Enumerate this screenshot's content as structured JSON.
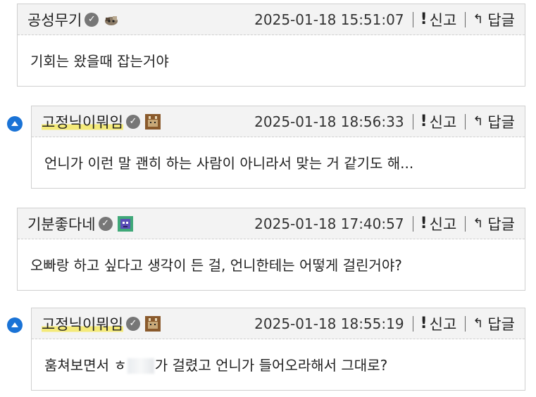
{
  "comments": [
    {
      "nickname": "공성무기",
      "verified_mark": "✓",
      "level_icon": "rock-mascot-icon",
      "date": "2025-01-18 15:51:07",
      "report_label": "신고",
      "reply_label": "답글",
      "text": "기회는 왔을때 잡는거야",
      "is_reply": false
    },
    {
      "nickname": "고정닉이뭐임",
      "verified_mark": "✓",
      "level_icon": "brown-character-icon",
      "date": "2025-01-18 18:56:33",
      "report_label": "신고",
      "reply_label": "답글",
      "text": "언니가 이런 말 괜히 하는 사람이 아니라서 맞는 거 같기도 해...",
      "is_reply": true
    },
    {
      "nickname": "기분좋다네",
      "verified_mark": "✓",
      "level_icon": "green-purple-character-icon",
      "date": "2025-01-18 17:40:57",
      "report_label": "신고",
      "reply_label": "답글",
      "text": "오빠랑 하고 싶다고 생각이 든 걸, 언니한테는 어떻게 걸린거야?",
      "is_reply": false
    },
    {
      "nickname": "고정닉이뭐임",
      "verified_mark": "✓",
      "level_icon": "brown-character-icon",
      "date": "2025-01-18 18:55:19",
      "report_label": "신고",
      "reply_label": "답글",
      "text_before": "훔쳐보면서 ㅎ",
      "text_after": "가 걸렸고 언니가 들어오라해서 그대로?",
      "is_reply": true
    }
  ],
  "colors": {
    "header_bg": "#f3f3f3",
    "border": "#cfcfcf",
    "highlight": "#f4ea79",
    "up_button": "#1a73d6"
  }
}
